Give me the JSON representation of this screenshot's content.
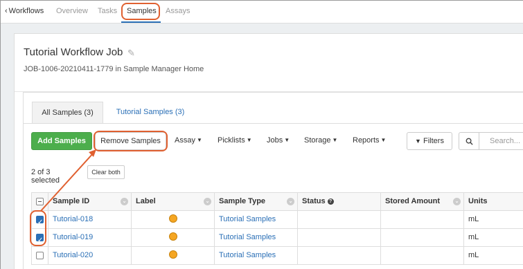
{
  "nav": {
    "back_label": "Workflows",
    "tabs": [
      {
        "label": "Overview"
      },
      {
        "label": "Tasks"
      },
      {
        "label": "Samples"
      },
      {
        "label": "Assays"
      }
    ]
  },
  "job": {
    "title": "Tutorial Workflow Job",
    "subtitle": "JOB-1006-20210411-1779 in Sample Manager Home"
  },
  "tabs": {
    "all_samples": "All Samples (3)",
    "tutorial_samples": "Tutorial Samples (3)"
  },
  "toolbar": {
    "add_label": "Add Samples",
    "remove_label": "Remove Samples",
    "menus": [
      "Assay",
      "Picklists",
      "Jobs",
      "Storage",
      "Reports"
    ],
    "filters_label": "Filters",
    "search_placeholder": "Search..."
  },
  "selection": {
    "text": "2 of 3 selected",
    "clear_label": "Clear both"
  },
  "grid": {
    "headers": [
      "Sample ID",
      "Label",
      "Sample Type",
      "Status",
      "Stored Amount",
      "Units"
    ],
    "rows": [
      {
        "id": "Tutorial-018",
        "type": "Tutorial Samples",
        "units": "mL",
        "checked": true
      },
      {
        "id": "Tutorial-019",
        "type": "Tutorial Samples",
        "units": "mL",
        "checked": true
      },
      {
        "id": "Tutorial-020",
        "type": "Tutorial Samples",
        "units": "mL",
        "checked": false
      }
    ]
  },
  "colors": {
    "accent": "#2a6fb6",
    "add_button": "#4cae4c",
    "highlight": "#e06030",
    "label_dot": "#f5a623"
  }
}
